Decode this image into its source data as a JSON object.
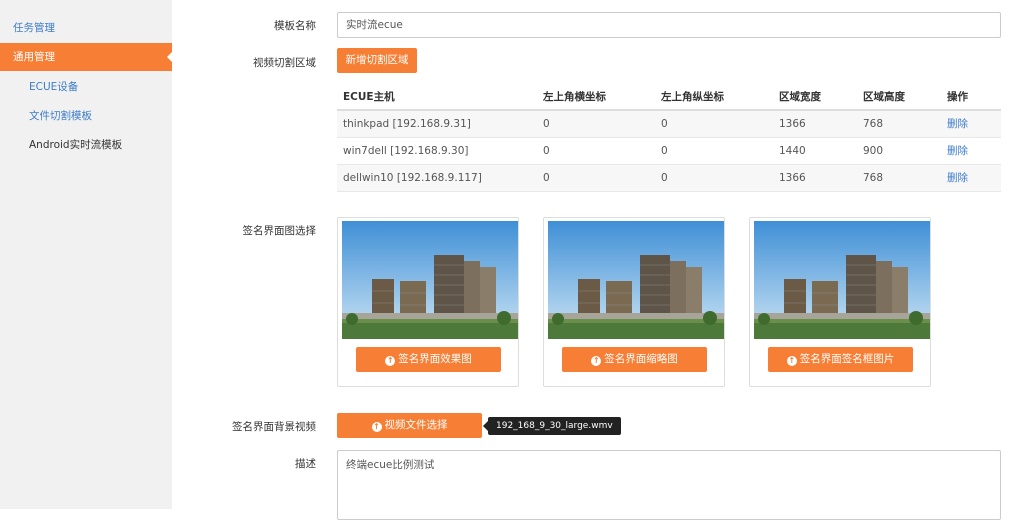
{
  "sidebar": {
    "items": [
      {
        "label": "任务管理"
      },
      {
        "label": "通用管理"
      },
      {
        "label": "ECUE设备"
      },
      {
        "label": "文件切割模板"
      },
      {
        "label": "Android实时流模板"
      }
    ]
  },
  "form": {
    "template_name_label": "模板名称",
    "template_name_value": "实时流ecue",
    "video_region_label": "视频切割区域",
    "add_region_button": "新增切割区域",
    "signature_image_label": "签名界面图选择",
    "background_video_label": "签名界面背景视频",
    "video_file_button": "视频文件选择",
    "video_file_name": "192_168_9_30_large.wmv",
    "description_label": "描述",
    "description_value": "终端ecue比例测试"
  },
  "table": {
    "headers": [
      "ECUE主机",
      "左上角横坐标",
      "左上角纵坐标",
      "区域宽度",
      "区域高度",
      "操作"
    ],
    "rows": [
      [
        "thinkpad [192.168.9.31]",
        "0",
        "0",
        "1366",
        "768",
        "删除"
      ],
      [
        "win7dell [192.168.9.30]",
        "0",
        "0",
        "1440",
        "900",
        "删除"
      ],
      [
        "dellwin10 [192.168.9.117]",
        "0",
        "0",
        "1366",
        "768",
        "删除"
      ]
    ]
  },
  "images": [
    {
      "button": "签名界面效果图"
    },
    {
      "button": "签名界面缩略图"
    },
    {
      "button": "签名界面签名框图片"
    }
  ],
  "colors": {
    "accent": "#f67f35",
    "link": "#3d7cc9",
    "sidebar_bg": "#f1f1f1"
  }
}
